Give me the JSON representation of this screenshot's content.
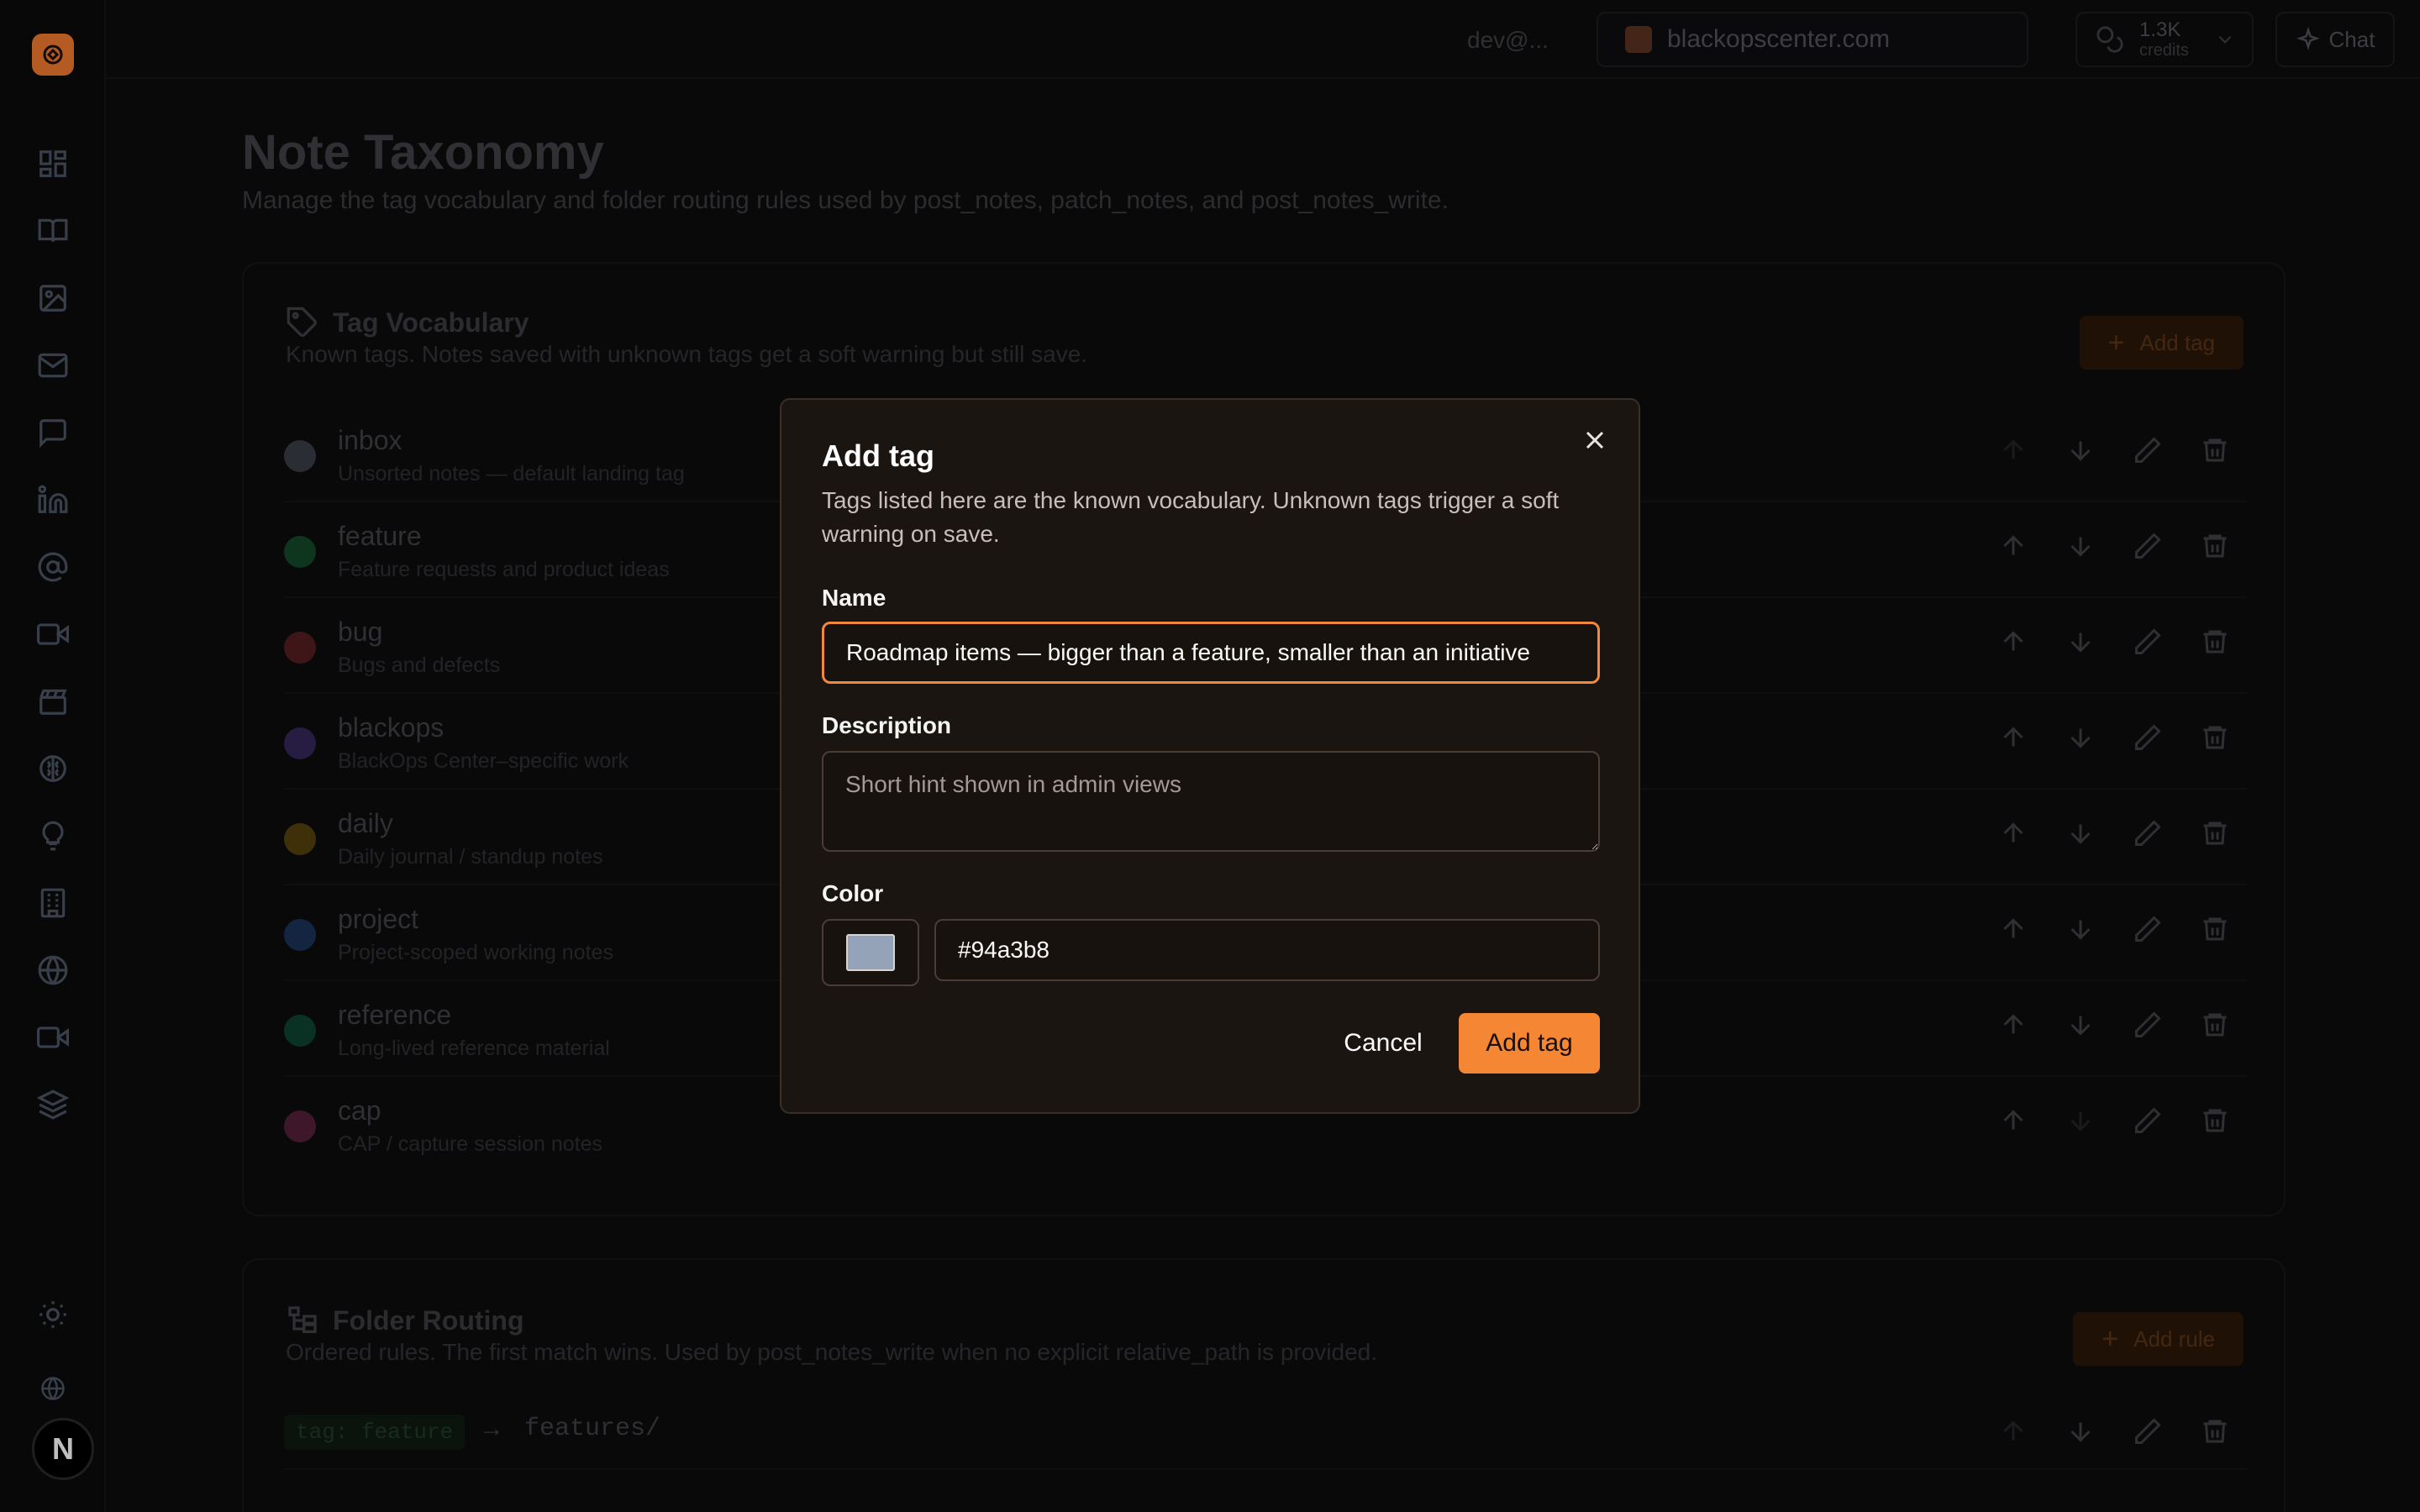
{
  "topbar": {
    "user_email": "dev@...",
    "site": "blackopscenter.com",
    "credits_value": "1.3K",
    "credits_label": "credits",
    "chat_label": "Chat"
  },
  "page": {
    "title": "Note Taxonomy",
    "subtitle": "Manage the tag vocabulary and folder routing rules used by post_notes, patch_notes, and post_notes_write."
  },
  "tag_vocab": {
    "title": "Tag Vocabulary",
    "subtitle": "Known tags. Notes saved with unknown tags get a soft warning but still save.",
    "add_label": "Add tag",
    "tags": [
      {
        "name": "inbox",
        "desc": "Unsorted notes — default landing tag",
        "color": "#94a3b8"
      },
      {
        "name": "feature",
        "desc": "Feature requests and product ideas",
        "color": "#22c55e"
      },
      {
        "name": "bug",
        "desc": "Bugs and defects",
        "color": "#ef4444"
      },
      {
        "name": "blackops",
        "desc": "BlackOps Center–specific work",
        "color": "#8b5cf6"
      },
      {
        "name": "daily",
        "desc": "Daily journal / standup notes",
        "color": "#eab308"
      },
      {
        "name": "project",
        "desc": "Project-scoped working notes",
        "color": "#3b82f6"
      },
      {
        "name": "reference",
        "desc": "Long-lived reference material",
        "color": "#10b981"
      },
      {
        "name": "cap",
        "desc": "CAP / capture session notes",
        "color": "#ec4899"
      }
    ]
  },
  "folder_routing": {
    "title": "Folder Routing",
    "subtitle": "Ordered rules. The first match wins. Used by post_notes_write when no explicit relative_path is provided.",
    "add_label": "Add rule",
    "rules": [
      {
        "match": "tag: feature",
        "arrow": "→",
        "path": "features/"
      }
    ]
  },
  "modal": {
    "title": "Add tag",
    "description": "Tags listed here are the known vocabulary. Unknown tags trigger a soft warning on save.",
    "name_label": "Name",
    "name_value": "Roadmap items — bigger than a feature, smaller than an initiative",
    "description_label": "Description",
    "description_placeholder": "Short hint shown in admin views",
    "color_label": "Color",
    "color_value": "#94a3b8",
    "cancel_label": "Cancel",
    "submit_label": "Add tag"
  },
  "colors": {
    "accent": "#f58634",
    "modal_bg": "#1b1512"
  }
}
